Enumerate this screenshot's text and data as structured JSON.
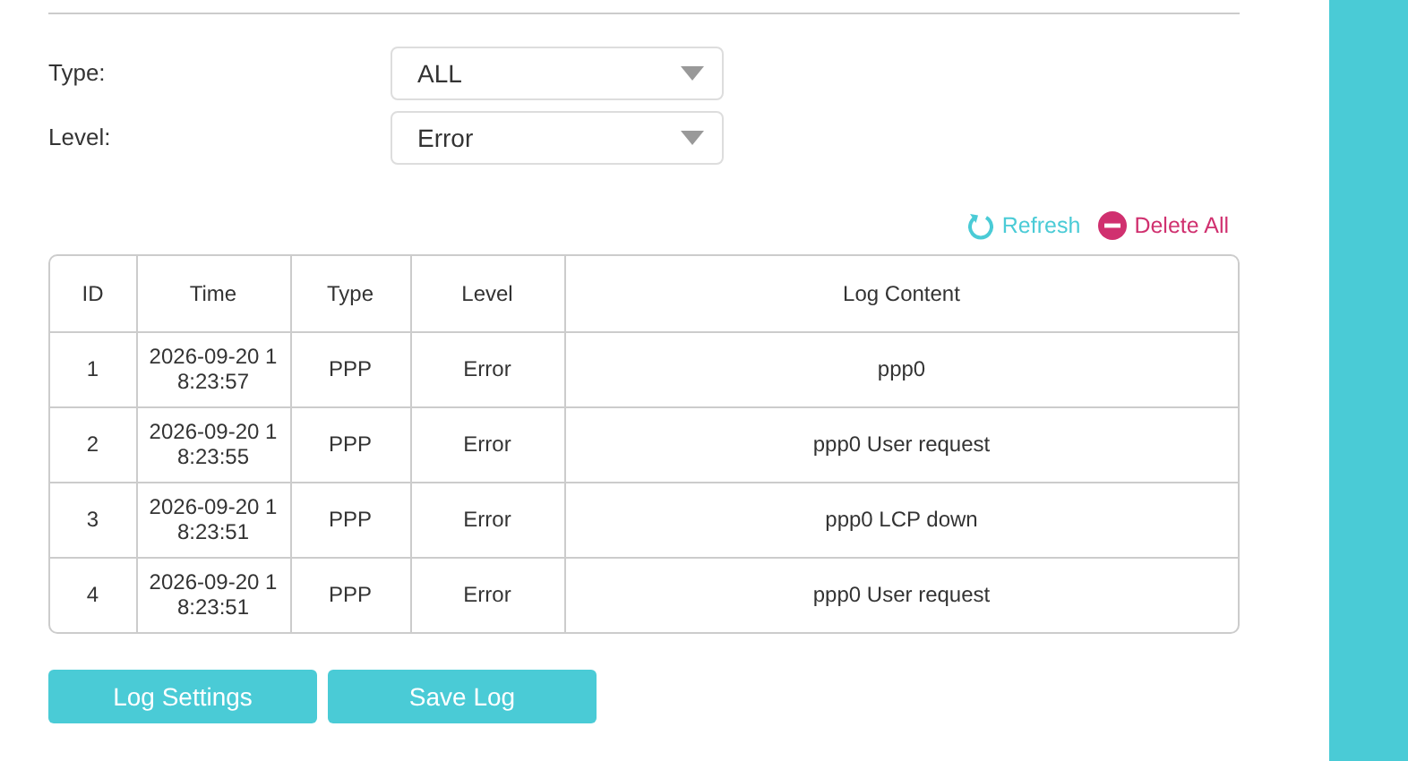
{
  "filters": [
    {
      "label": "Type:",
      "value": "ALL"
    },
    {
      "label": "Level:",
      "value": "Error"
    }
  ],
  "actions": [
    {
      "kind": "refresh",
      "label": "Refresh"
    },
    {
      "kind": "delete",
      "label": "Delete All"
    }
  ],
  "table": {
    "columns": [
      "ID",
      "Time",
      "Type",
      "Level",
      "Log Content"
    ],
    "rows": [
      [
        "1",
        "2026-09-20 18:23:57",
        "PPP",
        "Error",
        "ppp0"
      ],
      [
        "2",
        "2026-09-20 18:23:55",
        "PPP",
        "Error",
        "ppp0 User request"
      ],
      [
        "3",
        "2026-09-20 18:23:51",
        "PPP",
        "Error",
        "ppp0 LCP down"
      ],
      [
        "4",
        "2026-09-20 18:23:51",
        "PPP",
        "Error",
        "ppp0 User request"
      ]
    ]
  },
  "buttons": [
    "Log Settings",
    "Save Log"
  ]
}
